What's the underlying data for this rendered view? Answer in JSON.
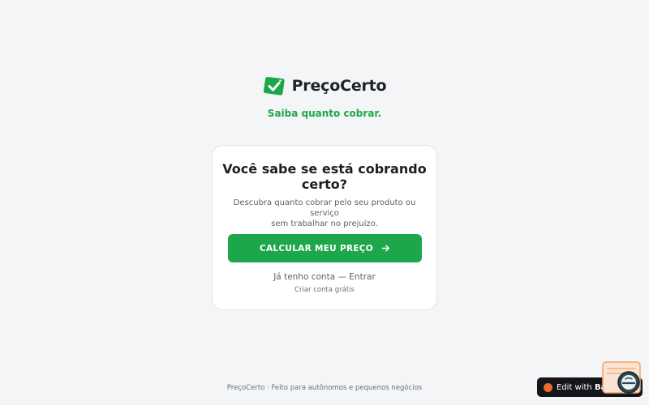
{
  "brand": {
    "name": "PreçoCerto",
    "tagline": "Saiba quanto cobrar."
  },
  "card": {
    "title_line1": "Você sabe se está cobrando",
    "title_line2": "certo?",
    "desc_line1": "Descubra quanto cobrar pelo seu produto ou serviço",
    "desc_line2": "sem trabalhar no prejuízo.",
    "cta_label": "CALCULAR MEU PREÇO",
    "login_link": "Já tenho conta — Entrar",
    "signup_link": "Criar conta grátis"
  },
  "footer": {
    "text": "PreçoCerto · Feito para autônomos e pequenos negócios"
  },
  "badge": {
    "prefix": "Edit with",
    "brand": "Base44"
  },
  "colors": {
    "accent": "#1ea64a",
    "background": "#f4f5f6",
    "card": "#ffffff",
    "badge": "#14161a",
    "badge_dot": "#f26b2a"
  },
  "icons": {
    "logo": "price-tag-check-icon",
    "cta": "arrow-right-icon",
    "widget": "chat-assistant-icon"
  }
}
